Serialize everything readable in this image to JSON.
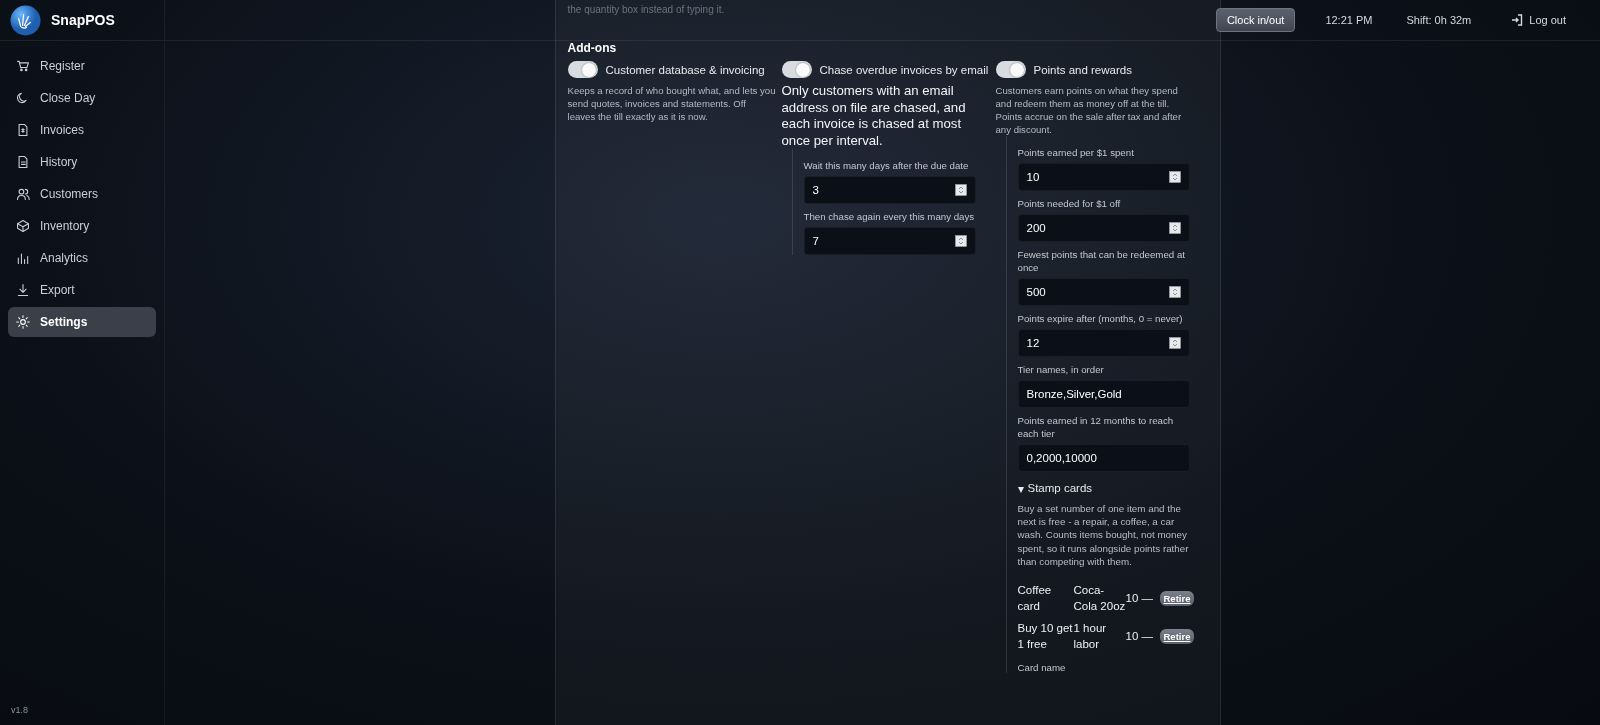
{
  "app": {
    "name": "SnapPOS",
    "version": "v1.8"
  },
  "sidebar": {
    "items": [
      {
        "label": "Register",
        "selected": false
      },
      {
        "label": "Close Day",
        "selected": false
      },
      {
        "label": "Invoices",
        "selected": false
      },
      {
        "label": "History",
        "selected": false
      },
      {
        "label": "Customers",
        "selected": false
      },
      {
        "label": "Inventory",
        "selected": false
      },
      {
        "label": "Analytics",
        "selected": false
      },
      {
        "label": "Export",
        "selected": false
      },
      {
        "label": "Settings",
        "selected": true
      }
    ]
  },
  "header": {
    "clock_button": "Clock in/out",
    "time": "12:21 PM",
    "shift": "Shift: 0h 32m",
    "logout": "Log out"
  },
  "settings": {
    "cut_text": "the quantity box instead of typing it.",
    "section_title": "Add-ons",
    "addons": [
      {
        "kind": "basic",
        "label": "Customer database & invoicing",
        "on": true,
        "description": "Keeps a record of who bought what, and lets you send quotes, invoices and statements. Off leaves the till exactly as it is now."
      },
      {
        "kind": "reminder",
        "label": "Chase overdue invoices by email",
        "on": true,
        "description": "Only customers with an email address on file are chased, and each invoice is chased at most once per interval.",
        "fields": [
          {
            "kind": "number",
            "label": "Wait this many days after the due date",
            "value": "3"
          },
          {
            "kind": "number",
            "label": "Then chase again every this many days",
            "value": "7"
          }
        ]
      },
      {
        "kind": "rewards",
        "label": "Points and rewards",
        "on": true,
        "description": "Customers earn points on what they spend and redeem them as money off at the till. Points accrue on the sale after tax and after any discount.",
        "fields": [
          {
            "kind": "number",
            "label": "Points earned per $1 spent",
            "value": "10"
          },
          {
            "kind": "number",
            "label": "Points needed for $1 off",
            "value": "200"
          },
          {
            "kind": "number",
            "label": "Fewest points that can be redeemed at once",
            "value": "500"
          },
          {
            "kind": "number",
            "label": "Points expire after (months, 0 = never)",
            "value": "12"
          },
          {
            "kind": "text",
            "label": "Tier names, in order",
            "value": "Bronze,Silver,Gold"
          },
          {
            "kind": "text",
            "label": "Points earned in 12 months to reach each tier",
            "value": "0,2000,10000"
          }
        ],
        "stamp_cards": {
          "marker": "▾",
          "title": "Stamp cards",
          "expanded": true,
          "description": "Buy a set number of one item and the next is free - a repair, a coffee, a car wash. Counts items bought, not money spent, so it runs alongside points rather than competing with them.",
          "cards": [
            {
              "name": "Coffee card",
              "item": "Coca-Cola 20oz",
              "count": "10 —",
              "action": "Retire"
            },
            {
              "name": "Buy 10 get 1 free",
              "item": "1 hour labor",
              "count": "10 —",
              "action": "Retire"
            }
          ],
          "next_field_label": "Card name"
        }
      }
    ]
  }
}
